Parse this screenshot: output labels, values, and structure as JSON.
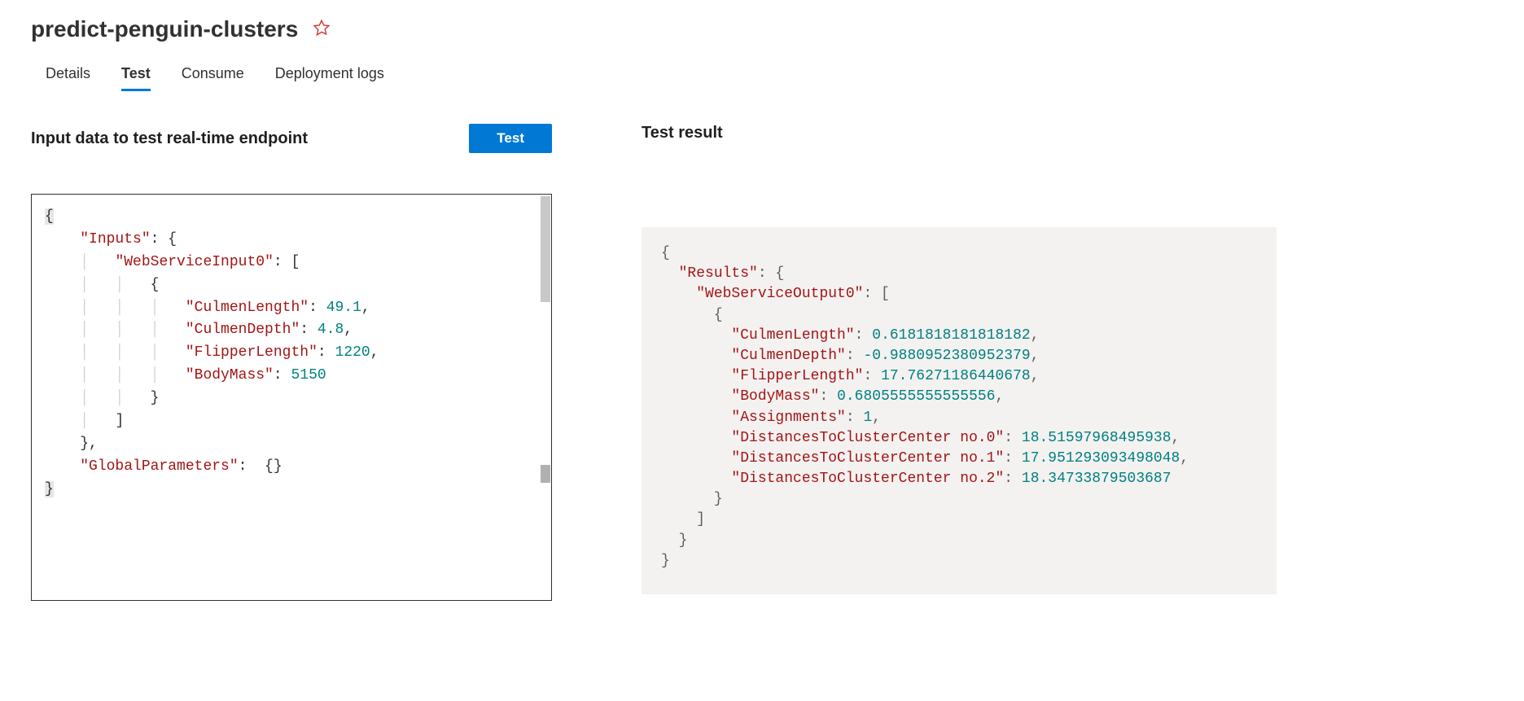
{
  "page": {
    "title": "predict-penguin-clusters"
  },
  "tabs": {
    "details": "Details",
    "test": "Test",
    "consume": "Consume",
    "logs": "Deployment logs"
  },
  "left": {
    "heading": "Input data to test real-time endpoint",
    "button": "Test"
  },
  "right": {
    "heading": "Test result"
  },
  "input_json": {
    "label_inputs": "\"Inputs\"",
    "label_wsi0": "\"WebServiceInput0\"",
    "k_culmenLength": "\"CulmenLength\"",
    "v_culmenLength": "49.1",
    "k_culmenDepth": "\"CulmenDepth\"",
    "v_culmenDepth": "4.8",
    "k_flipper": "\"FlipperLength\"",
    "v_flipper": "1220",
    "k_bodymass": "\"BodyMass\"",
    "v_bodymass": "5150",
    "label_global": "\"GlobalParameters\""
  },
  "output_json": {
    "k_results": "\"Results\"",
    "k_wso0": "\"WebServiceOutput0\"",
    "k_culmenLength": "\"CulmenLength\"",
    "v_culmenLength": "0.6181818181818182",
    "k_culmenDepth": "\"CulmenDepth\"",
    "v_culmenDepth": "-0.9880952380952379",
    "k_flipper": "\"FlipperLength\"",
    "v_flipper": "17.76271186440678",
    "k_bodymass": "\"BodyMass\"",
    "v_bodymass": "0.6805555555555556",
    "k_assign": "\"Assignments\"",
    "v_assign": "1",
    "k_d0": "\"DistancesToClusterCenter no.0\"",
    "v_d0": "18.51597968495938",
    "k_d1": "\"DistancesToClusterCenter no.1\"",
    "v_d1": "17.951293093498048",
    "k_d2": "\"DistancesToClusterCenter no.2\"",
    "v_d2": "18.34733879503687"
  }
}
